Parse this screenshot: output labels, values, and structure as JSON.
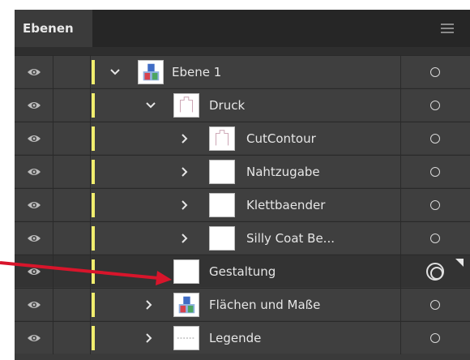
{
  "panel": {
    "tab_label": "Ebenen",
    "menu_icon": "hamburger-menu-icon"
  },
  "layers": [
    {
      "label": "Ebene 1",
      "depth": 0,
      "expanded": true,
      "thumb": "colored"
    },
    {
      "label": "Druck",
      "depth": 1,
      "expanded": true,
      "thumb": "outline"
    },
    {
      "label": "CutContour",
      "depth": 2,
      "expanded": false,
      "thumb": "outline"
    },
    {
      "label": "Nahtzugabe",
      "depth": 2,
      "expanded": false,
      "thumb": "blank"
    },
    {
      "label": "Klettbaender",
      "depth": 2,
      "expanded": false,
      "thumb": "blank"
    },
    {
      "label": "Silly Coat Be...",
      "depth": 2,
      "expanded": false,
      "thumb": "blank"
    },
    {
      "label": "Gestaltung",
      "depth": 1,
      "expanded": null,
      "thumb": "blank",
      "selected": true
    },
    {
      "label": "Flächen und Maße",
      "depth": 1,
      "expanded": false,
      "thumb": "colored"
    },
    {
      "label": "Legende",
      "depth": 1,
      "expanded": false,
      "thumb": "dashed"
    }
  ],
  "colors": {
    "layer_color": "#f1ee6e",
    "arrow": "#d8152b"
  }
}
